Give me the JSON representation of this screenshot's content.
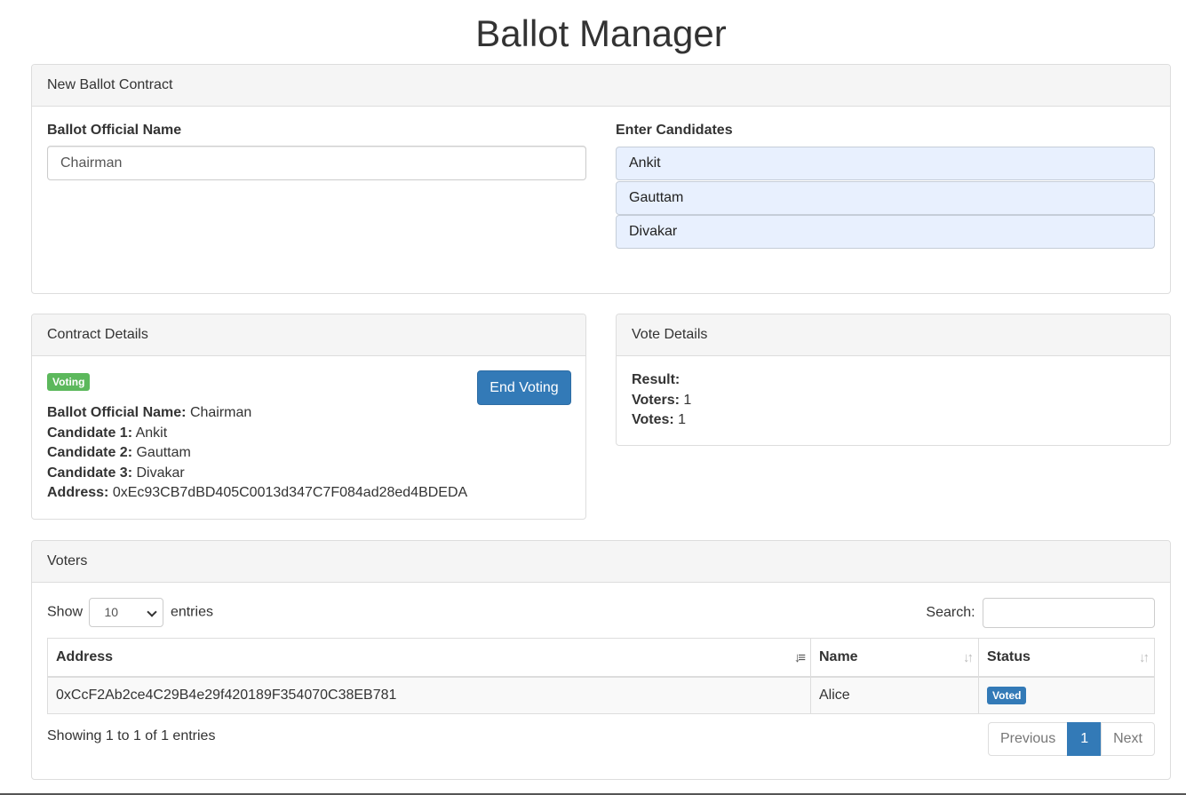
{
  "page": {
    "title": "Ballot Manager"
  },
  "new_ballot": {
    "heading": "New Ballot Contract",
    "official_label": "Ballot Official Name",
    "official_value": "Chairman",
    "candidates_label": "Enter Candidates",
    "candidates": [
      "Ankit",
      "Gauttam",
      "Divakar"
    ]
  },
  "contract": {
    "heading": "Contract Details",
    "status_badge": "Voting",
    "end_button": "End Voting",
    "official_label": "Ballot Official Name:",
    "official_value": "Chairman",
    "candidate1_label": "Candidate 1:",
    "candidate1_value": "Ankit",
    "candidate2_label": "Candidate 2:",
    "candidate2_value": "Gauttam",
    "candidate3_label": "Candidate 3:",
    "candidate3_value": "Divakar",
    "address_label": "Address:",
    "address_value": "0xEc93CB7dBD405C0013d347C7F084ad28ed4BDEDA"
  },
  "vote": {
    "heading": "Vote Details",
    "result_label": "Result:",
    "result_value": "",
    "voters_label": "Voters:",
    "voters_value": "1",
    "votes_label": "Votes:",
    "votes_value": "1"
  },
  "voters": {
    "heading": "Voters",
    "show_label": "Show",
    "entries_value": "10",
    "entries_label": "entries",
    "search_label": "Search:",
    "columns": [
      "Address",
      "Name",
      "Status"
    ],
    "rows": [
      {
        "address": "0xCcF2Ab2ce4C29B4e29f420189F354070C38EB781",
        "name": "Alice",
        "status": "Voted"
      }
    ],
    "showing_text": "Showing 1 to 1 of 1 entries",
    "pager": {
      "previous": "Previous",
      "current": "1",
      "next": "Next"
    }
  },
  "colors": {
    "primary": "#337ab7",
    "success": "#5cb85c",
    "panel_heading_bg": "#f5f5f5"
  }
}
